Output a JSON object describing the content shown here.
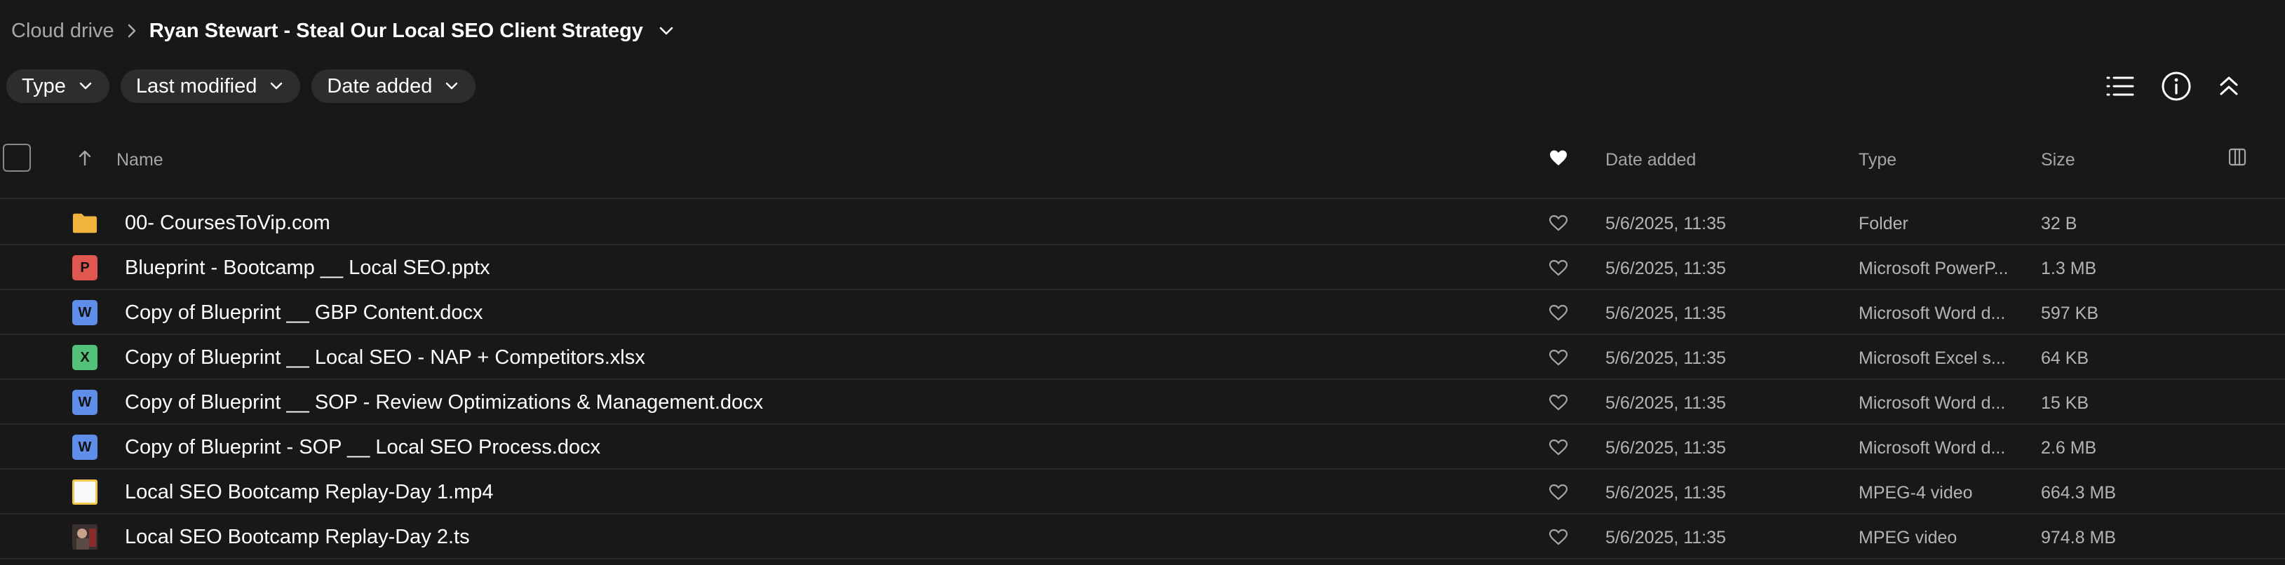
{
  "breadcrumb": {
    "root": "Cloud drive",
    "current": "Ryan Stewart - Steal Our Local SEO Client Strategy"
  },
  "filters": [
    {
      "label": "Type"
    },
    {
      "label": "Last modified"
    },
    {
      "label": "Date added"
    }
  ],
  "toolbar_icons": [
    "list-view-icon",
    "info-icon",
    "collapse-icon"
  ],
  "table": {
    "columns": {
      "name": "Name",
      "date_added": "Date added",
      "type": "Type",
      "size": "Size"
    },
    "rows": [
      {
        "icon": "folder",
        "name": "00- CoursesToVip.com",
        "date": "5/6/2025, 11:35",
        "type": "Folder",
        "size": "32 B"
      },
      {
        "icon": "powerpoint",
        "icon_letter": "P",
        "name": "Blueprint - Bootcamp __ Local SEO.pptx",
        "date": "5/6/2025, 11:35",
        "type": "Microsoft PowerP...",
        "size": "1.3 MB"
      },
      {
        "icon": "word",
        "icon_letter": "W",
        "name": "Copy of Blueprint __ GBP Content.docx",
        "date": "5/6/2025, 11:35",
        "type": "Microsoft Word d...",
        "size": "597 KB"
      },
      {
        "icon": "excel",
        "icon_letter": "X",
        "name": "Copy of Blueprint __ Local SEO - NAP + Competitors.xlsx",
        "date": "5/6/2025, 11:35",
        "type": "Microsoft Excel s...",
        "size": "64 KB"
      },
      {
        "icon": "word",
        "icon_letter": "W",
        "name": "Copy of Blueprint __ SOP - Review Optimizations & Management.docx",
        "date": "5/6/2025, 11:35",
        "type": "Microsoft Word d...",
        "size": "15 KB"
      },
      {
        "icon": "word",
        "icon_letter": "W",
        "name": "Copy of Blueprint - SOP __ Local SEO Process.docx",
        "date": "5/6/2025, 11:35",
        "type": "Microsoft Word d...",
        "size": "2.6 MB"
      },
      {
        "icon": "video-blank",
        "name": "Local SEO Bootcamp Replay-Day 1.mp4",
        "date": "5/6/2025, 11:35",
        "type": "MPEG-4 video",
        "size": "664.3 MB"
      },
      {
        "icon": "video-thumb",
        "name": "Local SEO Bootcamp Replay-Day 2.ts",
        "date": "5/6/2025, 11:35",
        "type": "MPEG video",
        "size": "974.8 MB"
      }
    ]
  },
  "colors": {
    "background": "#181818",
    "chip": "#2d2d2d",
    "folder": "#f2b33d",
    "powerpoint": "#e0574f",
    "word": "#5f8ee8",
    "excel": "#52c27a"
  }
}
